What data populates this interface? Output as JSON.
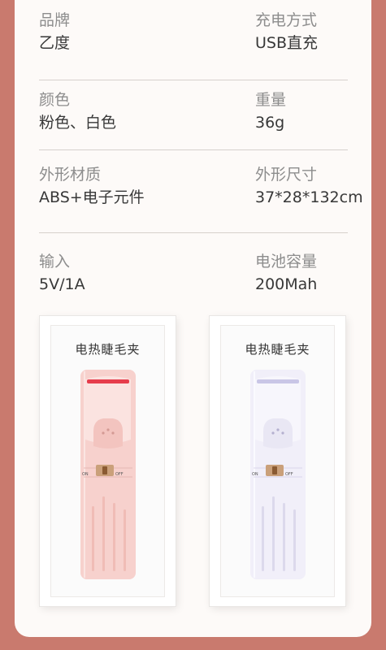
{
  "specs": [
    {
      "left_label": "品牌",
      "left_value": "乙度",
      "right_label": "充电方式",
      "right_value": "USB直充"
    },
    {
      "left_label": "颜色",
      "left_value": "粉色、白色",
      "right_label": "重量",
      "right_value": "36g"
    },
    {
      "left_label": "外形材质",
      "left_value": "ABS+电子元件",
      "right_label": "外形尺寸",
      "right_value": "37*28*132cm"
    },
    {
      "left_label": "输入",
      "left_value": "5V/1A",
      "right_label": "电池容量",
      "right_value": "200Mah"
    }
  ],
  "products": [
    {
      "box_label": "电热睫毛夹",
      "color": "pink",
      "body_hex": "#f7d1cd",
      "heater_hex": "#e63d4c",
      "switch_on": "ON",
      "switch_off": "OFF"
    },
    {
      "box_label": "电热睫毛夹",
      "color": "white",
      "body_hex": "#f1eff9",
      "heater_hex": "#c9c6e6",
      "switch_on": "ON",
      "switch_off": "OFF"
    }
  ]
}
